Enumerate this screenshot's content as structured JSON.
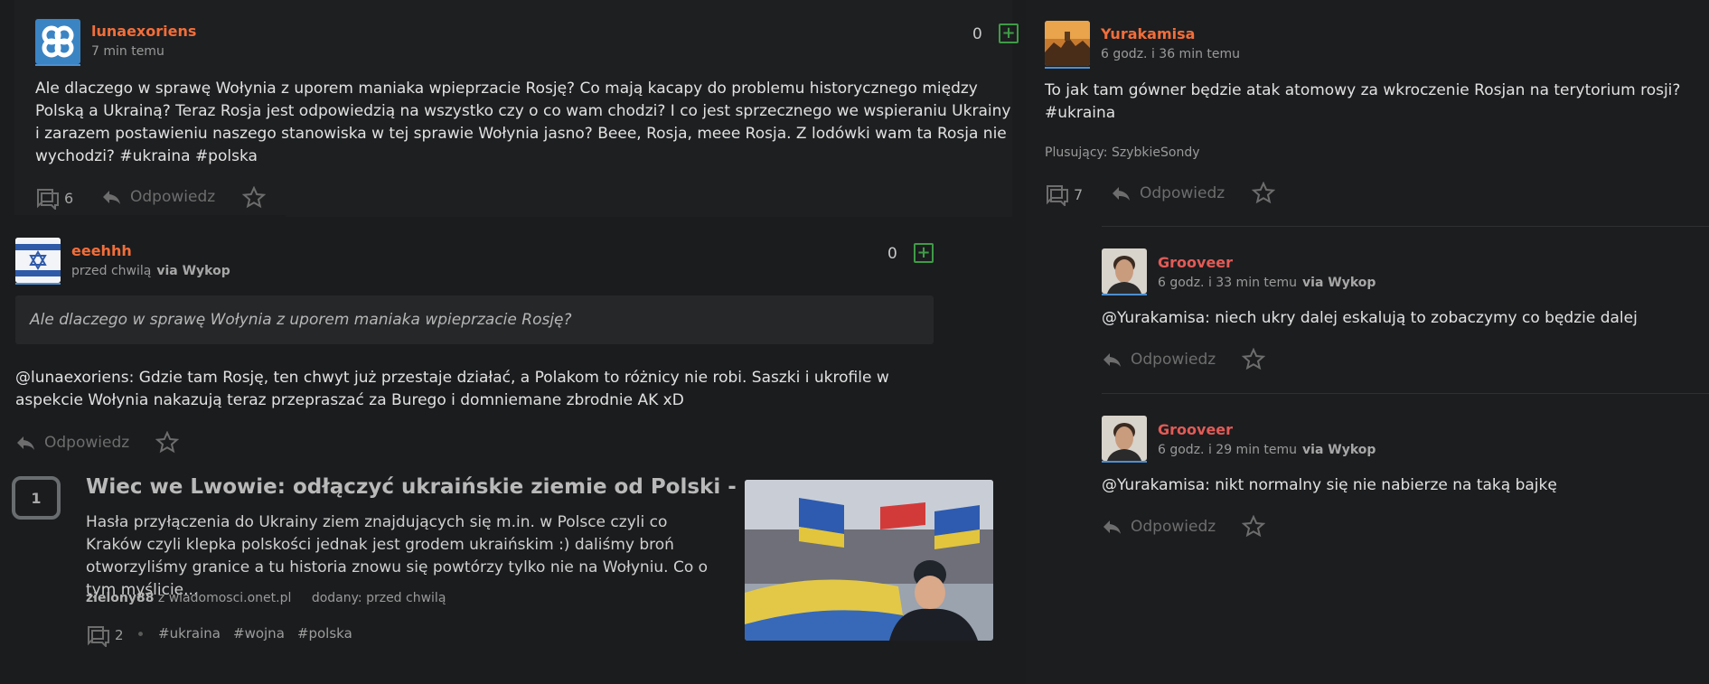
{
  "left_entry": {
    "username": "lunaexoriens",
    "time": "7 min temu",
    "votes": "0",
    "body": "Ale dlaczego w sprawę Wołynia z uporem maniaka wpieprzacie Rosję? Co mają kacapy do problemu historycznego między Polską a Ukrainą? Teraz Rosja jest odpowiedzią na wszystko czy o co wam chodzi? I co jest sprzecznego we wspieraniu Ukrainy i zarazem postawieniu naszego stanowiska w tej sprawie Wołynia jasno? Beee, Rosja, meee Rosja. Z lodówki wam ta Rosja nie wychodzi? #ukraina #polska",
    "comments": "6",
    "reply_label": "Odpowiedz"
  },
  "left_reply": {
    "username": "eeehhh",
    "time": "przed chwilą",
    "via": "via Wykop",
    "votes": "0",
    "quote": "Ale dlaczego w sprawę Wołynia z uporem maniaka wpieprzacie Rosję?",
    "mention": "@lunaexoriens",
    "body": ": Gdzie tam Rosję, ten chwyt już przestaje działać, a Polakom to różnicy nie robi. Saszki i ukrofile w aspekcie Wołynia nakazują teraz przepraszać za Burego i domniemane zbrodnie AK xD",
    "reply_label": "Odpowiedz"
  },
  "link_entry": {
    "rank": "1",
    "title": "Wiec we Lwowie: odłączyć ukraińskie ziemie od Polski -",
    "description": "Hasła przyłączenia do Ukrainy ziem znajdujących się m.in. w Polsce czyli co Kraków czyli klepka polskości jednak jest grodem ukraińskim :) daliśmy broń otworzyliśmy granice a tu historia znowu się powtórzy tylko nie na Wołyniu. Co o tym myślicie...",
    "author": "zielony88",
    "source_prefix": "z",
    "source": "wiadomosci.onet.pl",
    "added_label": "dodany:",
    "added_time": "przed chwilą",
    "comments": "2",
    "tags": [
      "#ukraina",
      "#wojna",
      "#polska"
    ]
  },
  "right_entry": {
    "username": "Yurakamisa",
    "time": "6 godz. i 36 min temu",
    "body": "To jak tam gówner będzie atak atomowy za wkroczenie Rosjan na terytorium rosji? #ukraina",
    "plus_label": "Plusujący:",
    "plus_users": "SzybkieSondy",
    "comments": "7",
    "reply_label": "Odpowiedz"
  },
  "right_comments": [
    {
      "username": "Grooveer",
      "time": "6 godz. i 33 min temu",
      "via": "via Wykop",
      "mention": "@Yurakamisa",
      "body": ": niech ukry dalej eskalują to zobaczymy co będzie dalej",
      "reply_label": "Odpowiedz"
    },
    {
      "username": "Grooveer",
      "time": "6 godz. i 29 min temu",
      "via": "via Wykop",
      "mention": "@Yurakamisa",
      "body": ": nikt normalny się nie nabierze na taką bajkę",
      "reply_label": "Odpowiedz"
    }
  ],
  "colors": {
    "username_orange": "#f26e3a",
    "username_red": "#e25b57",
    "vote_green": "#3f9b47"
  }
}
